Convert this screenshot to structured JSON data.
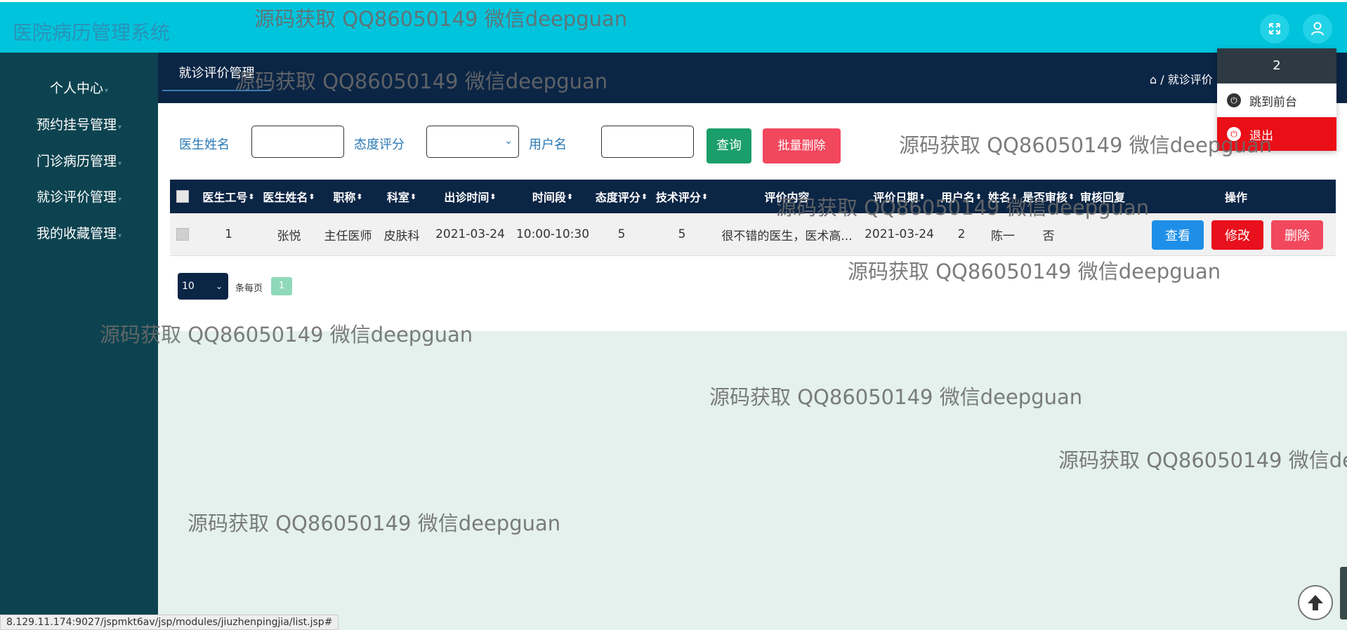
{
  "app": {
    "title": "医院病历管理系统"
  },
  "header_icons": [
    "fullscreen-icon",
    "user-icon"
  ],
  "sidebar": {
    "items": [
      {
        "label": "个人中心"
      },
      {
        "label": "预约挂号管理"
      },
      {
        "label": "门诊病历管理"
      },
      {
        "label": "就诊评价管理"
      },
      {
        "label": "我的收藏管理"
      }
    ]
  },
  "tab": {
    "label": "就诊评价管理"
  },
  "breadcrumb": {
    "home": "⌂",
    "separator": "/",
    "current": "就诊评价"
  },
  "search": {
    "doctor_name_label": "医生姓名",
    "doctor_name_value": "",
    "attitude_label": "态度评分",
    "attitude_value": "",
    "username_label": "用户名",
    "username_value": "",
    "query_button": "查询",
    "batch_delete_button": "批量删除"
  },
  "table": {
    "columns": [
      "医生工号",
      "医生姓名",
      "职称",
      "科室",
      "出诊时间",
      "时间段",
      "态度评分",
      "技术评分",
      "评价内容",
      "评价日期",
      "用户名",
      "姓名",
      "是否审核",
      "审核回复",
      "操作"
    ],
    "rows": [
      {
        "doctor_id": "1",
        "doctor_name": "张悦",
        "title": "主任医师",
        "department": "皮肤科",
        "visit_date": "2021-03-24",
        "time_slot": "10:00-10:30",
        "attitude_score": "5",
        "tech_score": "5",
        "content": "很不错的医生，医术高...",
        "review_date": "2021-03-24",
        "username": "2",
        "name": "陈一",
        "audited": "否",
        "audit_reply": "",
        "actions": {
          "view": "查看",
          "edit": "修改",
          "delete": "删除"
        }
      }
    ]
  },
  "pager": {
    "page_size": "10",
    "per_page_label": "条每页",
    "current_page": "1"
  },
  "user_menu": {
    "username": "2",
    "items": [
      {
        "label": "跳到前台"
      },
      {
        "label": "退出"
      }
    ]
  },
  "status_url": "8.129.11.174:9027/jspmkt6av/jsp/modules/jiuzhenpingjia/list.jsp#",
  "watermark": "源码获取 QQ86050149 微信deepguan",
  "colors": {
    "topbar": "#00c4dc",
    "sidebar": "#0d4350",
    "header": "#0b2545",
    "query_btn": "#1a9e6a",
    "batch_delete_btn": "#f2485e",
    "view_btn": "#1e8fe8",
    "edit_btn": "#e8101c",
    "delete_btn": "#f2485e",
    "logout_item": "#ea0e16"
  }
}
